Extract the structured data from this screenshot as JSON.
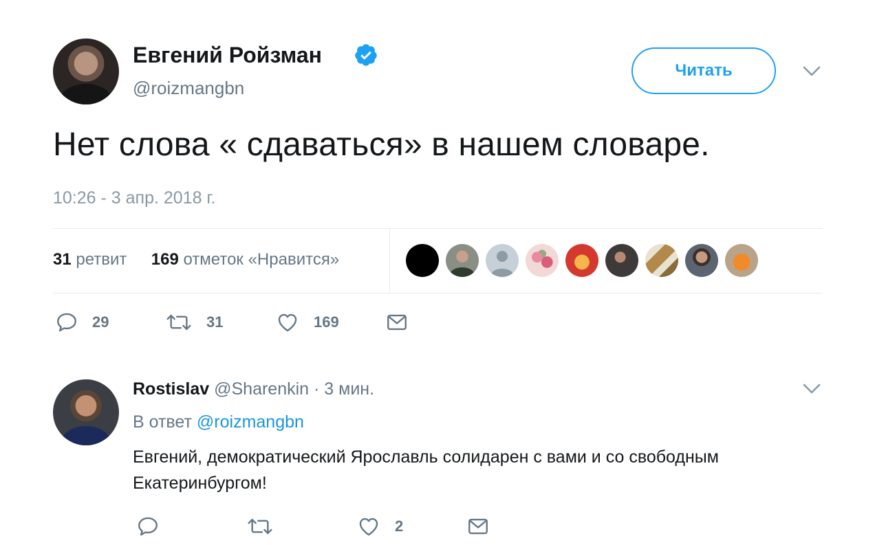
{
  "tweet": {
    "author_name": "Евгений Ройзман",
    "author_handle": "@roizmangbn",
    "follow_label": "Читать",
    "text": "Нет слова « сдаваться» в нашем словаре.",
    "timestamp": "10:26 - 3 апр. 2018 г.",
    "stats": {
      "retweets_count": "31",
      "retweets_label": "ретвит",
      "likes_count": "169",
      "likes_label": "отметок «Нравится»"
    },
    "actions": {
      "reply_count": "29",
      "retweet_count": "31",
      "like_count": "169"
    },
    "icons": [
      "verified-badge-icon",
      "chevron-down-icon",
      "reply-icon",
      "retweet-icon",
      "like-icon",
      "message-icon"
    ],
    "colors": {
      "accent": "#1da1f2",
      "link": "#1b95e0",
      "muted": "#657786",
      "timestamp": "#8899a6"
    }
  },
  "reply": {
    "author_name": "Rostislav",
    "author_handle": "@Sharenkin",
    "time": "· 3 мин.",
    "in_reply_prefix": "В ответ",
    "in_reply_mention": "@roizmangbn",
    "text": "Евгений, демократический Ярославль солидарен с вами и со свободным Екатеринбургом!",
    "actions": {
      "like_count": "2"
    }
  }
}
